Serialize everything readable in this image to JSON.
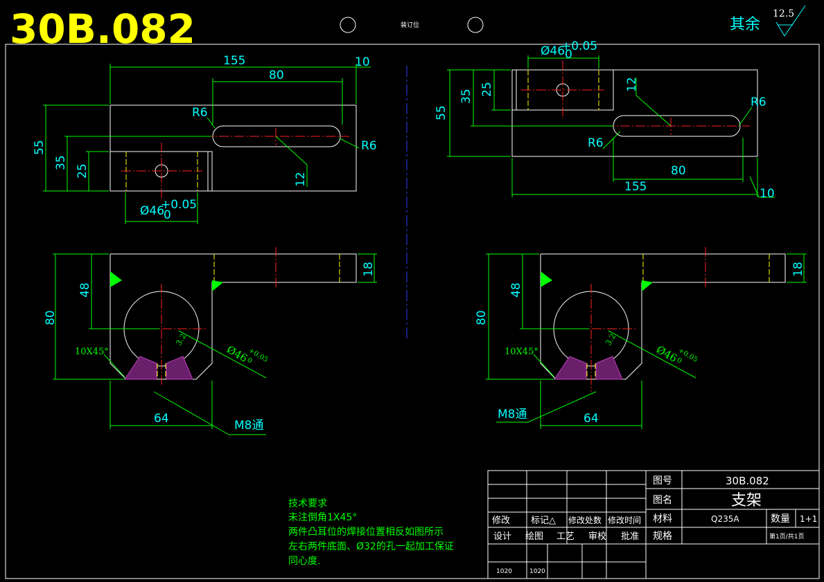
{
  "drawing_number_big": "30B.082",
  "binding_label": "装订位",
  "surface_finish": {
    "prefix": "其余",
    "value": "12.5"
  },
  "views": {
    "dim_155": "155",
    "dim_80": "80",
    "dim_10": "10",
    "dim_55": "55",
    "dim_35": "35",
    "dim_25": "25",
    "dim_12": "12",
    "dim_R6": "R6",
    "dim_d46": "Ø46",
    "tol_plus": "+0.05",
    "tol_zero": "0",
    "dim_48": "48",
    "dim_80v": "80",
    "dim_18": "18",
    "dim_64": "64",
    "chamfer": "10X45°",
    "thread": "M8通",
    "roughness_small": "3.2"
  },
  "tech_req": {
    "title": "技术要求",
    "line1": "未注倒角1X45°",
    "line2": "两件凸耳位的焊接位置相反如图所示",
    "line3": "左右两件底面、Ø32的孔一起加工保证",
    "line4": "同心度."
  },
  "title_block": {
    "drawing_no_label": "图号",
    "drawing_no": "30B.082",
    "name_label": "图名",
    "name": "支架",
    "material_label": "材料",
    "material": "Q235A",
    "qty_label": "数量",
    "qty": "1+1",
    "spec_label": "规格",
    "sheet": "第1页/共1页",
    "rev_cols": [
      "修改",
      "标记△",
      "修改处数",
      "修改时间"
    ],
    "sign_cols": [
      "设计",
      "绘图",
      "工艺",
      "审校",
      "批准"
    ],
    "date1": "1020",
    "date2": "1020"
  }
}
